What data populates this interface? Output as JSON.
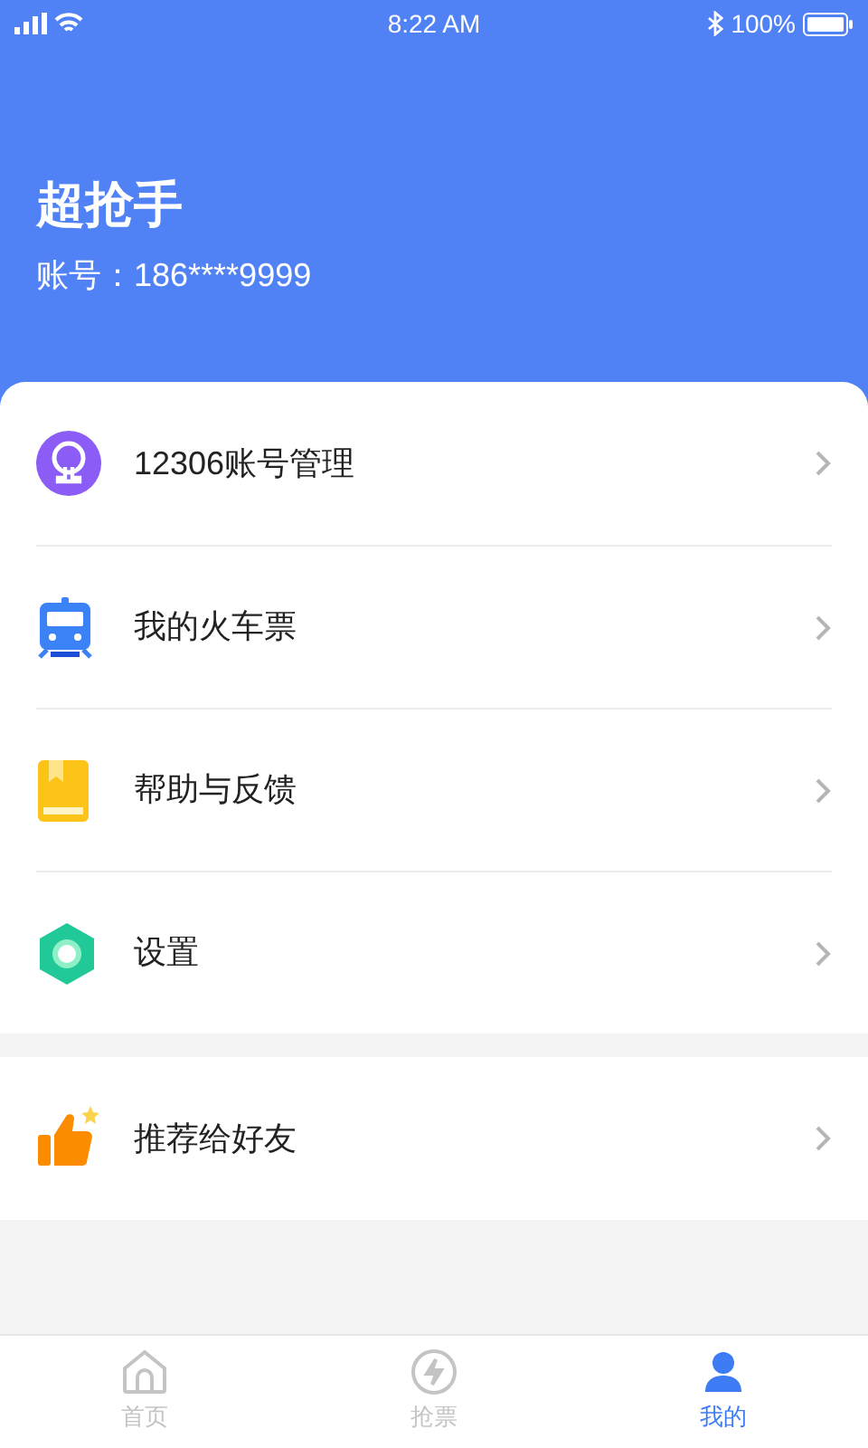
{
  "status_bar": {
    "time": "8:22 AM",
    "battery": "100%"
  },
  "profile": {
    "name": "超抢手",
    "account_label": "账号：",
    "account": "186****9999"
  },
  "menu_groups": [
    {
      "items": [
        {
          "kind": "account",
          "label": "12306账号管理"
        },
        {
          "kind": "train",
          "label": "我的火车票"
        },
        {
          "kind": "help",
          "label": "帮助与反馈"
        },
        {
          "kind": "settings",
          "label": "设置"
        }
      ]
    },
    {
      "items": [
        {
          "kind": "recommend",
          "label": "推荐给好友"
        }
      ]
    }
  ],
  "tab_bar": [
    {
      "kind": "home",
      "label": "首页",
      "selected": false
    },
    {
      "kind": "grab",
      "label": "抢票",
      "selected": false
    },
    {
      "kind": "me",
      "label": "我的",
      "selected": true
    }
  ]
}
